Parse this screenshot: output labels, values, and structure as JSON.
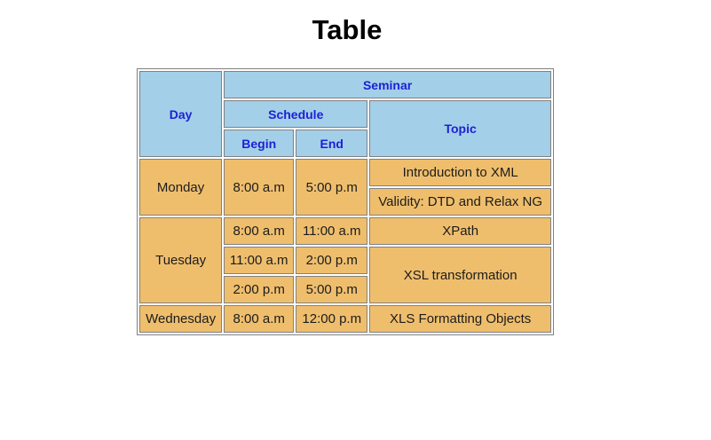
{
  "page": {
    "title": "Table"
  },
  "colors": {
    "header_background": "#a3cfe8",
    "header_text": "#1d21d6",
    "cell_background": "#efbe6d",
    "border": "#808080"
  },
  "table": {
    "headers": {
      "day": "Day",
      "seminar": "Seminar",
      "schedule": "Schedule",
      "topic": "Topic",
      "begin": "Begin",
      "end": "End"
    },
    "rows": [
      {
        "day": "Monday",
        "begin": "8:00 a.m",
        "end": "5:00 p.m",
        "topic": "Introduction to XML"
      },
      {
        "topic": "Validity: DTD and Relax NG"
      },
      {
        "day": "Tuesday",
        "begin": "8:00 a.m",
        "end": "11:00 a.m",
        "topic": "XPath"
      },
      {
        "begin": "11:00 a.m",
        "end": "2:00 p.m",
        "topic": "XSL transformation"
      },
      {
        "begin": "2:00 p.m",
        "end": "5:00 p.m"
      },
      {
        "day": "Wednesday",
        "begin": "8:00 a.m",
        "end": "12:00 p.m",
        "topic": "XLS Formatting Objects"
      }
    ]
  }
}
